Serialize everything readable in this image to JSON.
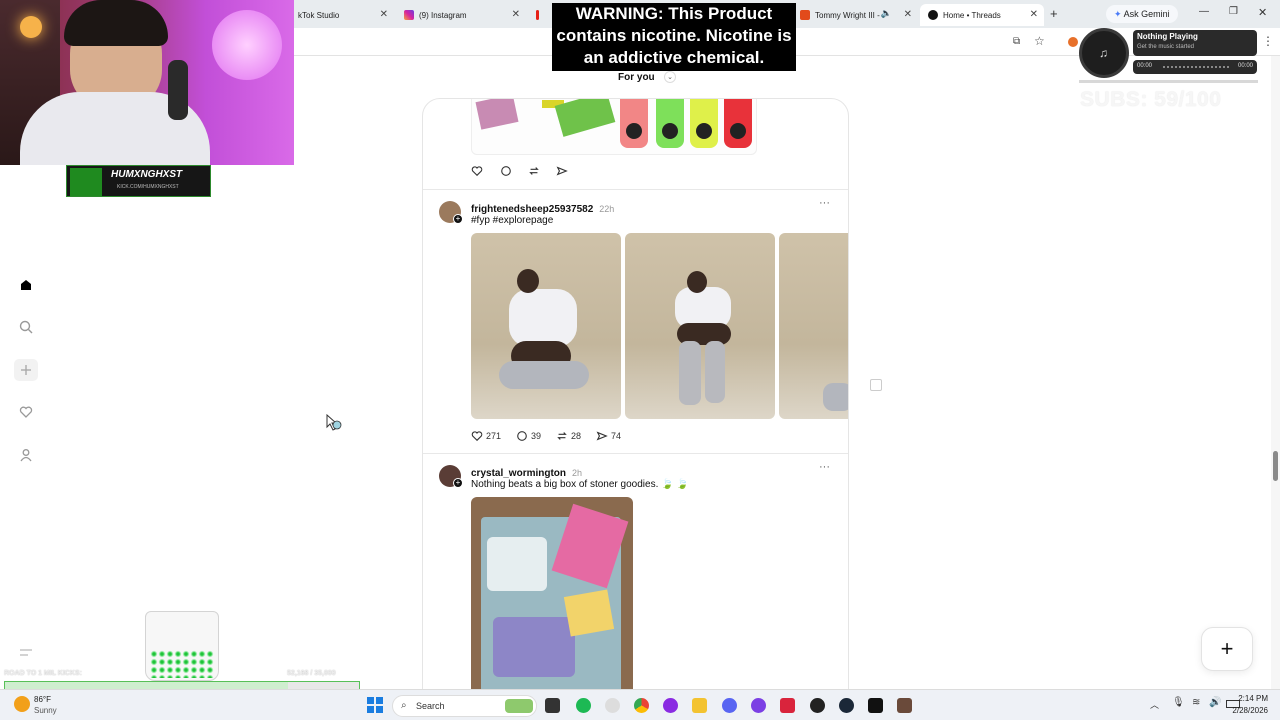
{
  "browser": {
    "tabs": [
      {
        "label": "kTok Studio"
      },
      {
        "label": "(9) Instagram"
      },
      {
        "label": "Tommy Wright III -"
      },
      {
        "label": "Home • Threads"
      }
    ],
    "ask_gemini": "Ask Gemini"
  },
  "threads": {
    "feed_label": "For you",
    "post1": {
      "actions": {
        "like": "",
        "comment": "",
        "repost": "",
        "share": ""
      }
    },
    "post2": {
      "username": "frightenedsheep25937582",
      "time": "22h",
      "text": "#fyp #explorepage",
      "likes": "271",
      "comments": "39",
      "reposts": "28",
      "shares": "74"
    },
    "post3": {
      "username": "crystal_wormington",
      "time": "2h",
      "text": "Nothing beats a big box of stoner goodies. 🍃 🍃"
    }
  },
  "stream_overlay": {
    "warning": "WARNING: This Product contains nicotine. Nicotine is an addictive chemical.",
    "channel_name": "HUMXNGHXST",
    "channel_url": "KICK.COM/HUMXNGHXST",
    "subs": "SUBS: 59/100",
    "music_title": "Nothing Playing",
    "music_sub": "Get the music started",
    "music_start": "00:00",
    "music_end": "00:00",
    "road_label": "ROAD TO 1 MIL KICKS:",
    "road_count": "52,168 / 35,000",
    "progress": 0.8
  },
  "taskbar": {
    "temp": "86°F",
    "weather": "Sunny",
    "search": "Search",
    "time": "2:14 PM",
    "date": "2/28/2026"
  }
}
